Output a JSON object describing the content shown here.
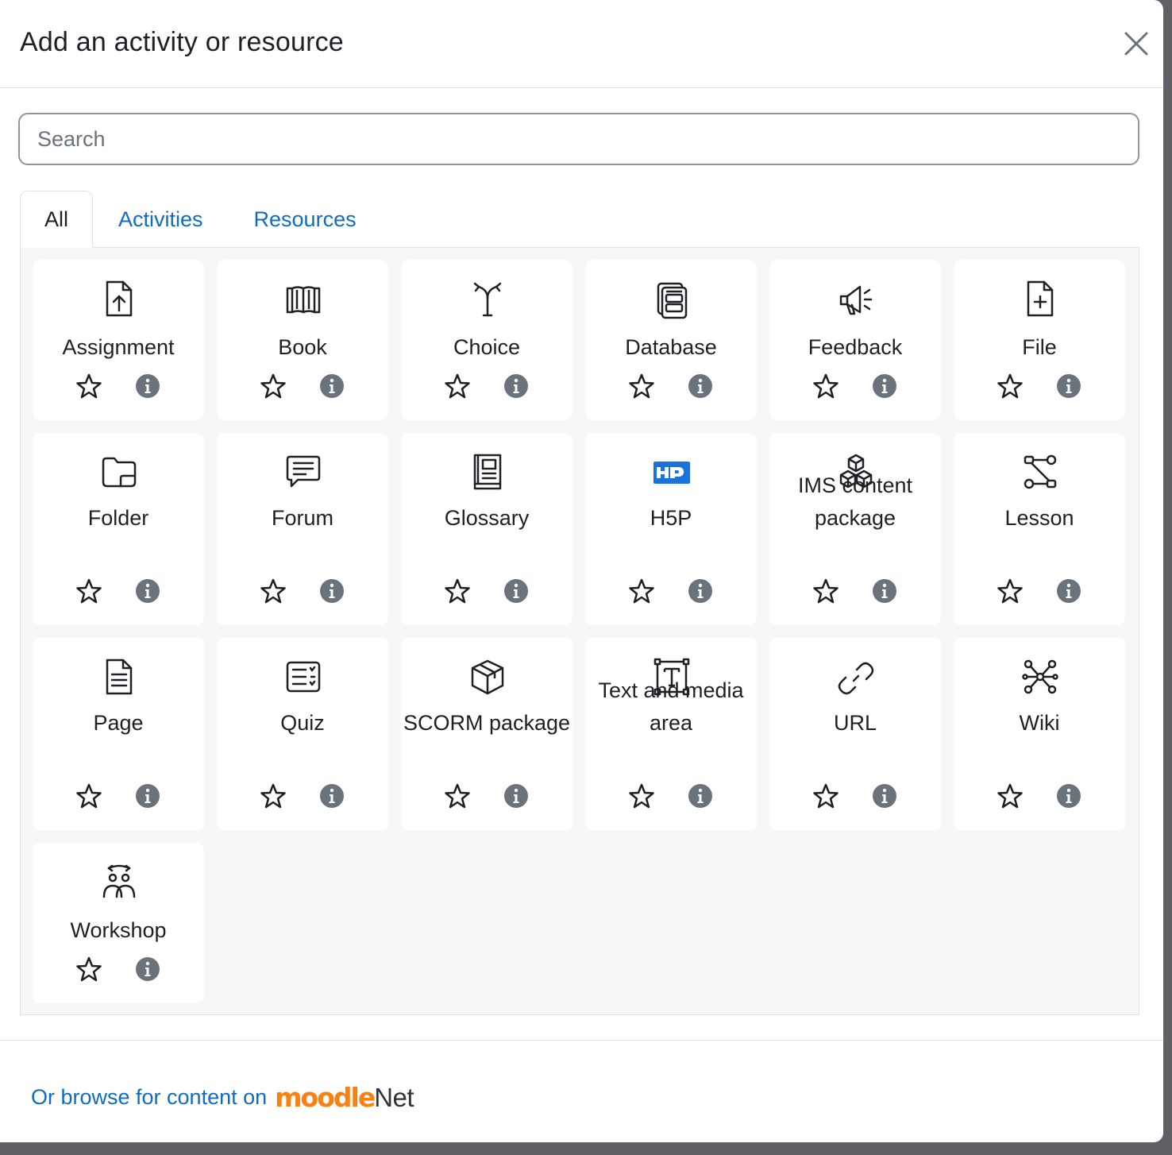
{
  "modal": {
    "title": "Add an activity or resource",
    "close_label": "Close"
  },
  "search": {
    "placeholder": "Search",
    "value": ""
  },
  "tabs": [
    {
      "label": "All",
      "active": true
    },
    {
      "label": "Activities",
      "active": false
    },
    {
      "label": "Resources",
      "active": false
    }
  ],
  "activities": [
    {
      "name": "Assignment",
      "icon": "assignment-icon"
    },
    {
      "name": "Book",
      "icon": "book-icon"
    },
    {
      "name": "Choice",
      "icon": "choice-icon"
    },
    {
      "name": "Database",
      "icon": "database-icon"
    },
    {
      "name": "Feedback",
      "icon": "feedback-icon"
    },
    {
      "name": "File",
      "icon": "file-icon"
    },
    {
      "name": "Folder",
      "icon": "folder-icon"
    },
    {
      "name": "Forum",
      "icon": "forum-icon"
    },
    {
      "name": "Glossary",
      "icon": "glossary-icon"
    },
    {
      "name": "H5P",
      "icon": "h5p-icon"
    },
    {
      "name": "IMS content package",
      "icon": "ims-content-package-icon"
    },
    {
      "name": "Lesson",
      "icon": "lesson-icon"
    },
    {
      "name": "Page",
      "icon": "page-icon"
    },
    {
      "name": "Quiz",
      "icon": "quiz-icon"
    },
    {
      "name": "SCORM package",
      "icon": "scorm-package-icon"
    },
    {
      "name": "Text and media area",
      "icon": "text-and-media-area-icon"
    },
    {
      "name": "URL",
      "icon": "url-icon"
    },
    {
      "name": "Wiki",
      "icon": "wiki-icon"
    },
    {
      "name": "Workshop",
      "icon": "workshop-icon"
    }
  ],
  "footer": {
    "browse_text": "Or browse for content on",
    "logo_moodle": "moodle",
    "logo_net": "Net"
  },
  "colors": {
    "link": "#0f6cbf",
    "text": "#1d2125",
    "moodle_orange": "#f98012",
    "h5p_blue": "#1a73d9",
    "info_grey": "#6a737b"
  }
}
